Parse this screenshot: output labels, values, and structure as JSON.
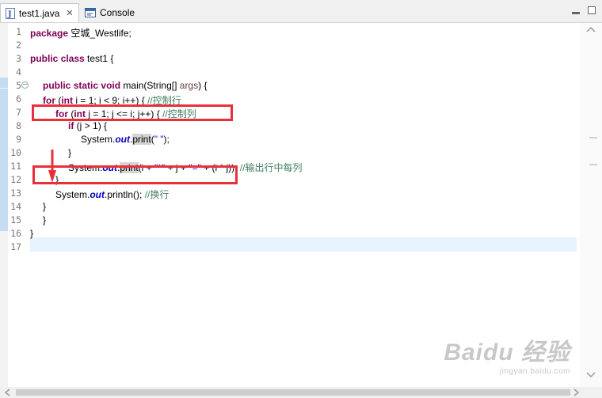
{
  "tabs": [
    {
      "label": "test1.java",
      "close": "✕"
    },
    {
      "label": "Console"
    }
  ],
  "line_numbers": [
    "1",
    "2",
    "3",
    "4",
    "5",
    "6",
    "7",
    "8",
    "9",
    "10",
    "11",
    "12",
    "13",
    "14",
    "15",
    "16",
    "17"
  ],
  "code": {
    "l1_kw": "package",
    "l1_rest": " 空城_Westlife;",
    "l3_kw1": "public",
    "l3_kw2": "class",
    "l3_rest": " test1 {",
    "l5_kw1": "public",
    "l5_kw2": "static",
    "l5_kw3": "void",
    "l5_rest1": " main(String[] ",
    "l5_var": "args",
    "l5_rest2": ") {",
    "l6_kw1": "for",
    "l6_mid1": " (",
    "l6_kw2": "int",
    "l6_rest": " i = 1; i < 9; i++) { ",
    "l6_cm": "//控制行",
    "l7_kw1": "for",
    "l7_mid1": " (",
    "l7_kw2": "int",
    "l7_rest": " j = 1; j <= i; j++) { ",
    "l7_cm": "//控制列",
    "l8_kw": "if",
    "l8_rest": " (j > 1) {",
    "l9_pre": "System.",
    "l9_field": "out",
    "l9_dot": ".",
    "l9_method": "print",
    "l9_open": "(",
    "l9_str": "\" \"",
    "l9_close": ");",
    "l10": "}",
    "l11_pre": "System.",
    "l11_field": "out",
    "l11_dot": ".",
    "l11_method": "print",
    "l11_a": "(i + ",
    "l11_s1": "\"*\"",
    "l11_b": " + j + ",
    "l11_s2": "\"=\"",
    "l11_c": " + (i * j)); ",
    "l11_cm": "//输出行中每列",
    "l12": "}",
    "l13_pre": "System.",
    "l13_field": "out",
    "l13_rest": ".println(); ",
    "l13_cm": "//换行",
    "l14": "}",
    "l15": "}",
    "l16": "}"
  },
  "watermark": {
    "main": "Baidu 经验",
    "sub": "jingyan.baidu.com"
  },
  "colors": {
    "annotation": "#e8303a",
    "keyword": "#7f0055",
    "comment": "#3f7f5f",
    "current_line": "#e8f2fe"
  }
}
